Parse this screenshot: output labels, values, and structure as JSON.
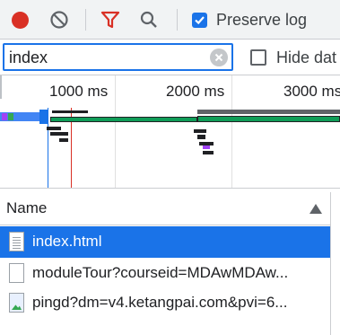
{
  "toolbar": {
    "record_icon": "record-dot-icon",
    "clear_icon": "block-icon",
    "filter_icon": "funnel-icon",
    "search_icon": "search-icon",
    "preserve_log_label": "Preserve log",
    "preserve_log_checked": true,
    "accent_red": "#d93025",
    "accent_blue": "#1a73e8"
  },
  "filter": {
    "value": "index",
    "clear_icon": "clear-circle-icon",
    "hide_data_label": "Hide dat",
    "hide_data_checked": false
  },
  "overview": {
    "ticks": [
      "1000 ms",
      "2000 ms",
      "3000 ms"
    ],
    "dom_content_loaded_color": "#1a73e8",
    "load_color": "#d93025"
  },
  "table": {
    "column_name": "Name",
    "sort_icon": "sort-ascending-icon",
    "rows": [
      {
        "name": "index.html",
        "icon": "document-icon",
        "selected": true
      },
      {
        "name": "moduleTour?courseid=MDAwMDAw...",
        "icon": "document-icon",
        "selected": false
      },
      {
        "name": "pingd?dm=v4.ketangpai.com&pvi=6...",
        "icon": "image-icon",
        "selected": false
      }
    ]
  }
}
